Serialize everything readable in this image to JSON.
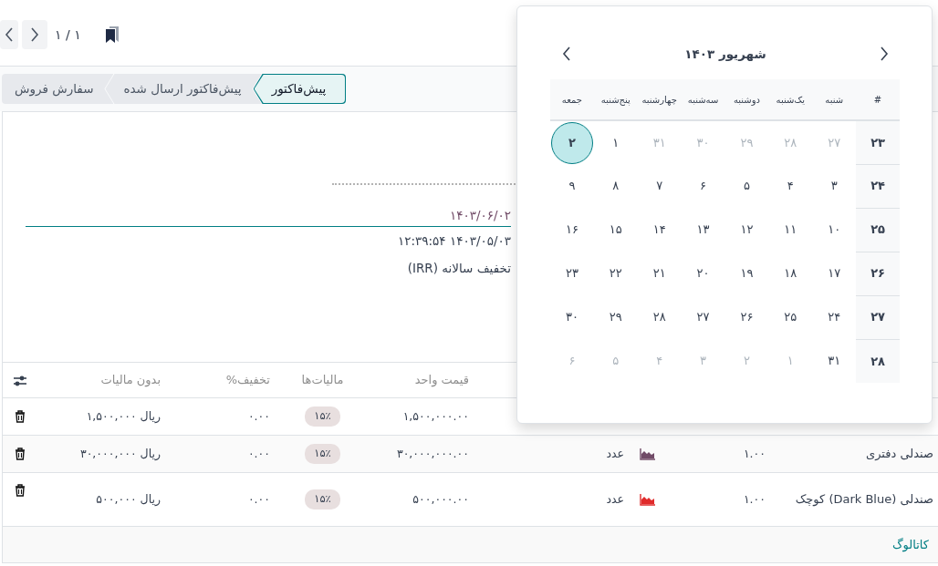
{
  "pager": {
    "value": "۱ / ۱"
  },
  "statusbar": [
    {
      "label": "پیش‌فاکتور",
      "selected": true
    },
    {
      "label": "پیش‌فاکتور ارسال شده",
      "selected": false
    },
    {
      "label": "سفارش فروش",
      "selected": false
    }
  ],
  "form": {
    "date_field": {
      "value": "۱۴۰۳/۰۶/۰۲",
      "focused": true
    },
    "created": "۱۴۰۳/۰۵/۰۳ ۱۲:۳۹:۵۴",
    "pricelist": "تخفیف سالانه (IRR)"
  },
  "table": {
    "headers": {
      "unit_price": "قیمت واحد",
      "taxes": "مالیات‌ها",
      "discount": "تخفیف%",
      "subtotal": "بدون مالیات"
    },
    "rows": [
      {
        "unit_price": "۱,۵۰۰,۰۰۰.۰۰",
        "taxes": "۱۵٪",
        "discount": "۰.۰۰",
        "subtotal": "ریال ۱,۵۰۰,۰۰۰"
      },
      {
        "product": "صندلی دفتری",
        "quantity": "۱.۰۰",
        "forecast": {
          "color": "#714b67"
        },
        "unit": "عدد",
        "unit_price": "۳۰,۰۰۰,۰۰۰.۰۰",
        "taxes": "۱۵٪",
        "discount": "۰.۰۰",
        "subtotal": "ریال ۳۰,۰۰۰,۰۰۰"
      },
      {
        "product": "صندلی (Dark Blue) کوچک",
        "quantity": "۱.۰۰",
        "forecast": {
          "color": "#e02b2b"
        },
        "unit": "عدد",
        "unit_price": "۵۰۰,۰۰۰.۰۰",
        "taxes": "۱۵٪",
        "discount": "۰.۰۰",
        "subtotal": "ریال ۵۰۰,۰۰۰"
      }
    ],
    "catalog_link": "کاتالوگ"
  },
  "calendar": {
    "title": "شهریور ۱۴۰۳",
    "week_header": "#",
    "weekdays": [
      "شنبه",
      "یک‌شنبه",
      "دوشنبه",
      "سه‌شنبه",
      "چهارشنبه",
      "پنج‌شنبه",
      "جمعه"
    ],
    "weeks": [
      {
        "number": "۲۳",
        "days": [
          {
            "label": "۲۷",
            "muted": true,
            "selected": false
          },
          {
            "label": "۲۸",
            "muted": true,
            "selected": false
          },
          {
            "label": "۲۹",
            "muted": true,
            "selected": false
          },
          {
            "label": "۳۰",
            "muted": true,
            "selected": false
          },
          {
            "label": "۳۱",
            "muted": true,
            "selected": false
          },
          {
            "label": "۱",
            "muted": false,
            "selected": false
          },
          {
            "label": "۲",
            "muted": false,
            "selected": true
          }
        ]
      },
      {
        "number": "۲۴",
        "days": [
          {
            "label": "۳",
            "muted": false,
            "selected": false
          },
          {
            "label": "۴",
            "muted": false,
            "selected": false
          },
          {
            "label": "۵",
            "muted": false,
            "selected": false
          },
          {
            "label": "۶",
            "muted": false,
            "selected": false
          },
          {
            "label": "۷",
            "muted": false,
            "selected": false
          },
          {
            "label": "۸",
            "muted": false,
            "selected": false
          },
          {
            "label": "۹",
            "muted": false,
            "selected": false
          }
        ]
      },
      {
        "number": "۲۵",
        "days": [
          {
            "label": "۱۰",
            "muted": false,
            "selected": false
          },
          {
            "label": "۱۱",
            "muted": false,
            "selected": false
          },
          {
            "label": "۱۲",
            "muted": false,
            "selected": false
          },
          {
            "label": "۱۳",
            "muted": false,
            "selected": false
          },
          {
            "label": "۱۴",
            "muted": false,
            "selected": false
          },
          {
            "label": "۱۵",
            "muted": false,
            "selected": false
          },
          {
            "label": "۱۶",
            "muted": false,
            "selected": false
          }
        ]
      },
      {
        "number": "۲۶",
        "days": [
          {
            "label": "۱۷",
            "muted": false,
            "selected": false
          },
          {
            "label": "۱۸",
            "muted": false,
            "selected": false
          },
          {
            "label": "۱۹",
            "muted": false,
            "selected": false
          },
          {
            "label": "۲۰",
            "muted": false,
            "selected": false
          },
          {
            "label": "۲۱",
            "muted": false,
            "selected": false
          },
          {
            "label": "۲۲",
            "muted": false,
            "selected": false
          },
          {
            "label": "۲۳",
            "muted": false,
            "selected": false
          }
        ]
      },
      {
        "number": "۲۷",
        "days": [
          {
            "label": "۲۴",
            "muted": false,
            "selected": false
          },
          {
            "label": "۲۵",
            "muted": false,
            "selected": false
          },
          {
            "label": "۲۶",
            "muted": false,
            "selected": false
          },
          {
            "label": "۲۷",
            "muted": false,
            "selected": false
          },
          {
            "label": "۲۸",
            "muted": false,
            "selected": false
          },
          {
            "label": "۲۹",
            "muted": false,
            "selected": false
          },
          {
            "label": "۳۰",
            "muted": false,
            "selected": false
          }
        ]
      },
      {
        "number": "۲۸",
        "days": [
          {
            "label": "۳۱",
            "muted": false,
            "selected": false
          },
          {
            "label": "۱",
            "muted": true,
            "selected": false
          },
          {
            "label": "۲",
            "muted": true,
            "selected": false
          },
          {
            "label": "۳",
            "muted": true,
            "selected": false
          },
          {
            "label": "۴",
            "muted": true,
            "selected": false
          },
          {
            "label": "۵",
            "muted": true,
            "selected": false
          },
          {
            "label": "۶",
            "muted": true,
            "selected": false
          }
        ]
      }
    ]
  }
}
